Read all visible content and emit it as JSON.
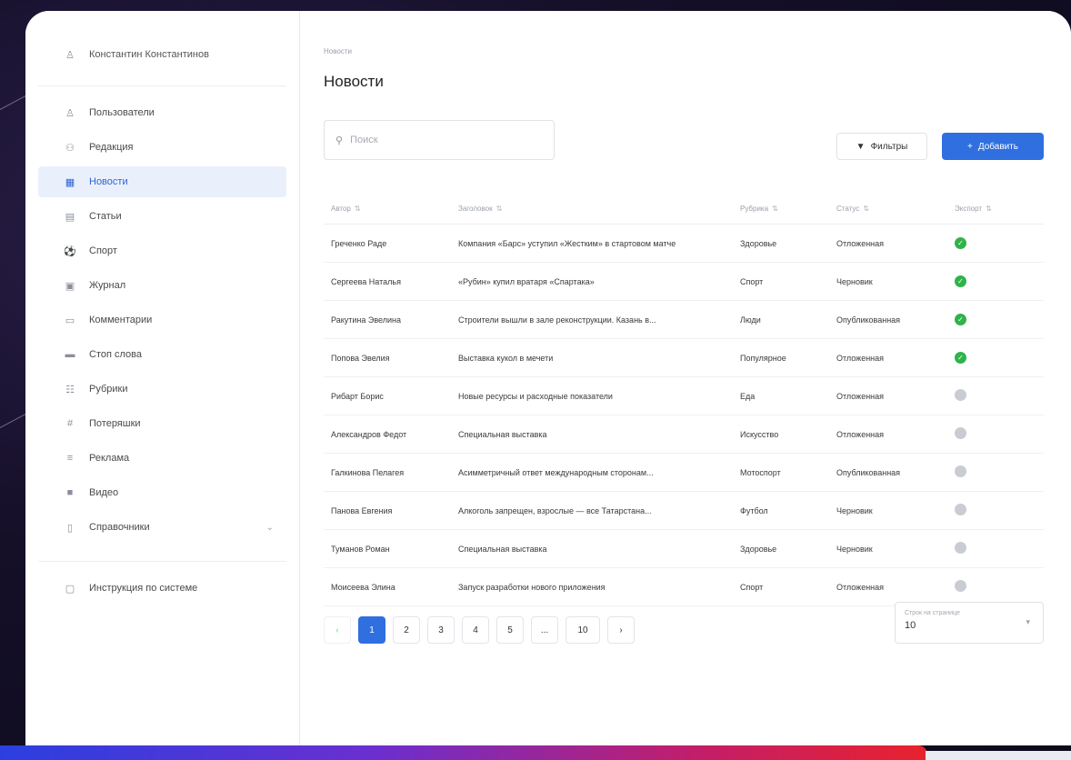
{
  "user": {
    "name": "Константин Константинов",
    "icon": "user-icon"
  },
  "sidebar": {
    "items": [
      {
        "label": "Пользователи",
        "icon": "person-icon",
        "glyph": "♙",
        "active": false
      },
      {
        "label": "Редакция",
        "icon": "team-icon",
        "glyph": "⚇",
        "active": false
      },
      {
        "label": "Новости",
        "icon": "news-icon",
        "glyph": "▦",
        "active": true
      },
      {
        "label": "Статьи",
        "icon": "article-icon",
        "glyph": "▤",
        "active": false
      },
      {
        "label": "Спорт",
        "icon": "sport-icon",
        "glyph": "⚽",
        "active": false
      },
      {
        "label": "Журнал",
        "icon": "magazine-icon",
        "glyph": "▣",
        "active": false
      },
      {
        "label": "Комментарии",
        "icon": "comment-icon",
        "glyph": "▭",
        "active": false
      },
      {
        "label": "Стоп слова",
        "icon": "stop-icon",
        "glyph": "▬",
        "active": false
      },
      {
        "label": "Рубрики",
        "icon": "rubric-icon",
        "glyph": "☷",
        "active": false
      },
      {
        "label": "Потеряшки",
        "icon": "tag-icon",
        "glyph": "#",
        "active": false
      },
      {
        "label": "Реклама",
        "icon": "ad-icon",
        "glyph": "≡",
        "active": false
      },
      {
        "label": "Видео",
        "icon": "video-icon",
        "glyph": "■",
        "active": false
      },
      {
        "label": "Справочники",
        "icon": "book-icon",
        "glyph": "▯",
        "active": false,
        "has_chevron": true
      }
    ],
    "help": {
      "label": "Инструкция по системе",
      "icon": "help-icon",
      "glyph": "▢"
    }
  },
  "main": {
    "breadcrumb": "Новости",
    "title": "Новости",
    "search": {
      "placeholder": "Поиск",
      "value": ""
    },
    "filters_label": "Фильтры",
    "add_label": "Добавить"
  },
  "table": {
    "headers": [
      "Автор",
      "Заголовок",
      "Рубрика",
      "Статус",
      "Экспорт"
    ],
    "rows": [
      {
        "author": "Греченко Раде",
        "title": "Компания «Барс» уступил «Жестким» в стартовом матче",
        "rubric": "Здоровье",
        "status": "Отложенная",
        "export": true
      },
      {
        "author": "Сергеева Наталья",
        "title": "«Рубин» купил вратаря «Спартака»",
        "rubric": "Спорт",
        "status": "Черновик",
        "export": true
      },
      {
        "author": "Ракутина Эвелина",
        "title": "Строители вышли в зале реконструкции. Казань в...",
        "rubric": "Люди",
        "status": "Опубликованная",
        "export": true
      },
      {
        "author": "Попова Эвелия",
        "title": "Выставка кукол в мечети",
        "rubric": "Популярное",
        "status": "Отложенная",
        "export": true
      },
      {
        "author": "Рибарт Борис",
        "title": "Новые ресурсы и расходные показатели",
        "rubric": "Еда",
        "status": "Отложенная",
        "export": false
      },
      {
        "author": "Александров Федот",
        "title": "Специальная выставка",
        "rubric": "Искусство",
        "status": "Отложенная",
        "export": false
      },
      {
        "author": "Галкинова Пелагея",
        "title": "Асимметричный ответ международным сторонам...",
        "rubric": "Мотоспорт",
        "status": "Опубликованная",
        "export": false
      },
      {
        "author": "Панова Евгения",
        "title": "Алкоголь запрещен, взрослые — все Татарстана...",
        "rubric": "Футбол",
        "status": "Черновик",
        "export": false
      },
      {
        "author": "Туманов Роман",
        "title": "Специальная выставка",
        "rubric": "Здоровье",
        "status": "Черновик",
        "export": false
      },
      {
        "author": "Моисеева Элина",
        "title": "Запуск разработки нового приложения",
        "rubric": "Спорт",
        "status": "Отложенная",
        "export": false
      }
    ]
  },
  "pagination": {
    "pages": [
      "1",
      "2",
      "3",
      "4",
      "5",
      "...",
      "10"
    ],
    "current": "1",
    "prev_icon": "chevron-left-icon",
    "next_icon": "chevron-right-icon"
  },
  "per_page": {
    "label": "Строк на странице",
    "value": "10"
  },
  "colors": {
    "accent": "#2f6fe0",
    "active_bg": "#eaf0fb",
    "export_on": "#2fb34a",
    "export_off": "#c9ccd2"
  }
}
